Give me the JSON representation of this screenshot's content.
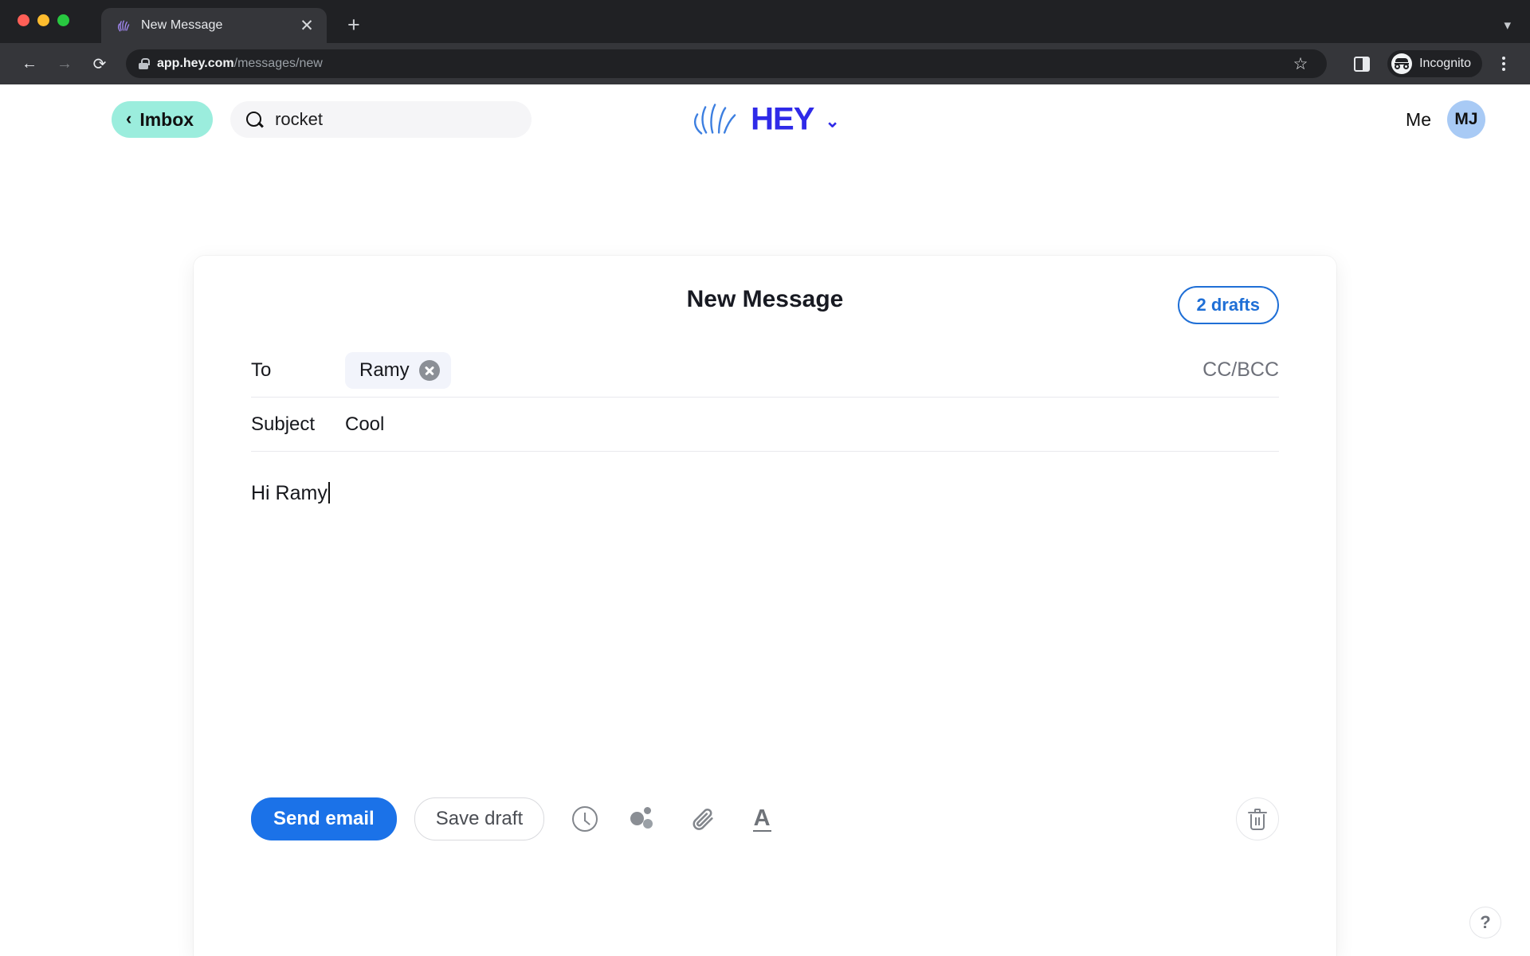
{
  "browser": {
    "tab": {
      "title": "New Message",
      "favicon_icon": "hey-hand-icon",
      "close_icon": "close-icon"
    },
    "new_tab_icon": "plus-icon",
    "tab_list_chevron_icon": "chevron-down-icon",
    "nav": {
      "back_icon": "arrow-left-icon",
      "forward_icon": "arrow-right-icon",
      "reload_icon": "reload-icon"
    },
    "omnibox": {
      "lock_icon": "lock-icon",
      "url_host": "app.hey.com",
      "url_path": "/messages/new",
      "star_icon": "star-icon"
    },
    "side_panel_icon": "side-panel-icon",
    "incognito_label": "Incognito",
    "incognito_icon": "incognito-icon",
    "menu_icon": "kebab-menu-icon"
  },
  "app_header": {
    "imbox_label": "Imbox",
    "imbox_back_icon": "chevron-left-icon",
    "imbox_bg": "#9beddd",
    "search": {
      "icon": "search-icon",
      "value": "rocket",
      "placeholder": "Search"
    },
    "logo": {
      "wordmark": "HEY",
      "hand_icon": "hey-hand-icon",
      "chevron_icon": "chevron-down-icon",
      "color": "#2f2ae8"
    },
    "me_label": "Me",
    "avatar_initials": "MJ",
    "avatar_bg": "#a8caf5"
  },
  "compose": {
    "title": "New Message",
    "drafts_label": "2 drafts",
    "drafts_color": "#1f6fd6",
    "to": {
      "label": "To",
      "recipients": [
        {
          "name": "Ramy",
          "remove_icon": "close-circle-icon"
        }
      ],
      "ccbcc_label": "CC/BCC"
    },
    "subject": {
      "label": "Subject",
      "value": "Cool"
    },
    "body": {
      "value": "Hi Ramy"
    },
    "toolbar": {
      "send_label": "Send email",
      "send_color": "#1b72e8",
      "save_draft_label": "Save draft",
      "icons": [
        {
          "name": "clock-icon",
          "title": "Send later"
        },
        {
          "name": "bubbles-icon",
          "title": "Reply tracking"
        },
        {
          "name": "paperclip-icon",
          "title": "Attach file"
        },
        {
          "name": "text-format-icon",
          "title": "Formatting",
          "glyph": "A"
        }
      ],
      "trash_icon": "trash-icon"
    }
  },
  "help": {
    "icon": "question-mark-icon",
    "glyph": "?"
  }
}
